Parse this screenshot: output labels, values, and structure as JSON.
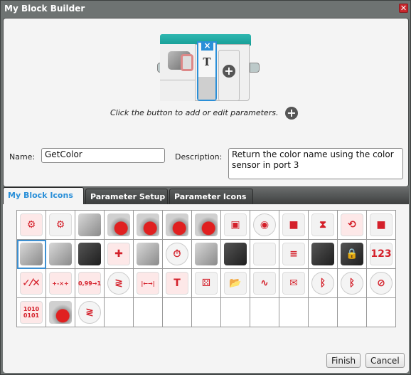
{
  "window": {
    "title": "My Block Builder",
    "close_icon": "close-icon"
  },
  "preview": {
    "parameter_glyph": "T",
    "remove_parameter_glyph": "×",
    "add_parameter_glyph": "+",
    "hint": "Click the button to add or edit parameters.",
    "hint_add_glyph": "+"
  },
  "form": {
    "name_label": "Name:",
    "name_value": "GetColor",
    "description_label": "Description:",
    "description_value": "Return the color name using the color sensor in port 3"
  },
  "tabs": [
    {
      "label": "My Block Icons",
      "active": true
    },
    {
      "label": "Parameter Setup",
      "active": false
    },
    {
      "label": "Parameter Icons",
      "active": false
    }
  ],
  "icons": [
    {
      "name": "brain-red-icon",
      "glyph": "⚙",
      "style": "red"
    },
    {
      "name": "brain-gray-icon",
      "glyph": "⚙",
      "style": "plain"
    },
    {
      "name": "medium-motor-icon",
      "glyph": "",
      "style": "gray"
    },
    {
      "name": "large-motor-icon",
      "glyph": "",
      "style": "motor"
    },
    {
      "name": "move-steering-icon",
      "glyph": "",
      "style": "motor"
    },
    {
      "name": "steering-wheel-motor-icon",
      "glyph": "",
      "style": "motor"
    },
    {
      "name": "move-tank-icon",
      "glyph": "",
      "style": "motor"
    },
    {
      "name": "display-icon",
      "glyph": "▣",
      "style": "plain"
    },
    {
      "name": "sound-icon",
      "glyph": "◉",
      "style": "round"
    },
    {
      "name": "brick-buttons-icon",
      "glyph": "■",
      "style": "plain"
    },
    {
      "name": "wait-hourglass-icon",
      "glyph": "⧗",
      "style": "plain"
    },
    {
      "name": "loop-interrupt-icon",
      "glyph": "⟲",
      "style": "red"
    },
    {
      "name": "brick-button-sensor-icon",
      "glyph": "■",
      "style": "plain"
    },
    {
      "name": "color-sensor-icon",
      "glyph": "",
      "style": "gray",
      "selected": true
    },
    {
      "name": "touch-sensor-icon",
      "glyph": "",
      "style": "gray"
    },
    {
      "name": "infrared-sensor-icon",
      "glyph": "",
      "style": "dark"
    },
    {
      "name": "infrared-beacon-icon",
      "glyph": "✚",
      "style": "red"
    },
    {
      "name": "motor-rotation-icon",
      "glyph": "",
      "style": "gray"
    },
    {
      "name": "timer-icon",
      "glyph": "⏱",
      "style": "round"
    },
    {
      "name": "gyro-sensor-icon",
      "glyph": "",
      "style": "gray"
    },
    {
      "name": "ultrasonic-sensor-icon",
      "glyph": "",
      "style": "dark"
    },
    {
      "name": "energy-meter-icon",
      "glyph": "",
      "style": "plain"
    },
    {
      "name": "file-access-icon",
      "glyph": "≡",
      "style": "plain"
    },
    {
      "name": "briefcase-icon",
      "glyph": "",
      "style": "dark"
    },
    {
      "name": "locked-briefcase-icon",
      "glyph": "🔒",
      "style": "dark"
    },
    {
      "name": "array-icon",
      "glyph": "123",
      "style": "plain"
    },
    {
      "name": "logic-operations-icon",
      "glyph": "✓⁄✕",
      "style": "red"
    },
    {
      "name": "math-icon",
      "glyph": "+-×÷",
      "style": "red"
    },
    {
      "name": "round-icon",
      "glyph": "0,99→1",
      "style": "red"
    },
    {
      "name": "compare-icon",
      "glyph": "≷",
      "style": "round"
    },
    {
      "name": "range-icon",
      "glyph": "|←→|",
      "style": "red"
    },
    {
      "name": "text-icon",
      "glyph": "T",
      "style": "red"
    },
    {
      "name": "random-icon",
      "glyph": "⚄",
      "style": "plain"
    },
    {
      "name": "file-folder-icon",
      "glyph": "📂",
      "style": "plain"
    },
    {
      "name": "datalogging-icon",
      "glyph": "∿",
      "style": "plain"
    },
    {
      "name": "messaging-icon",
      "glyph": "✉",
      "style": "plain"
    },
    {
      "name": "bluetooth-icon",
      "glyph": "ᛒ",
      "style": "round"
    },
    {
      "name": "bluetooth-settings-icon",
      "glyph": "ᛒ",
      "style": "round"
    },
    {
      "name": "keep-awake-icon",
      "glyph": "⊘",
      "style": "round"
    },
    {
      "name": "raw-sensor-value-icon",
      "glyph": "1010\n0101",
      "style": "red"
    },
    {
      "name": "unregulated-motor-icon",
      "glyph": "",
      "style": "motor"
    },
    {
      "name": "compare-alt-icon",
      "glyph": "≷",
      "style": "round"
    }
  ],
  "grid_total_cells": 52,
  "buttons": {
    "finish": "Finish",
    "cancel": "Cancel"
  }
}
